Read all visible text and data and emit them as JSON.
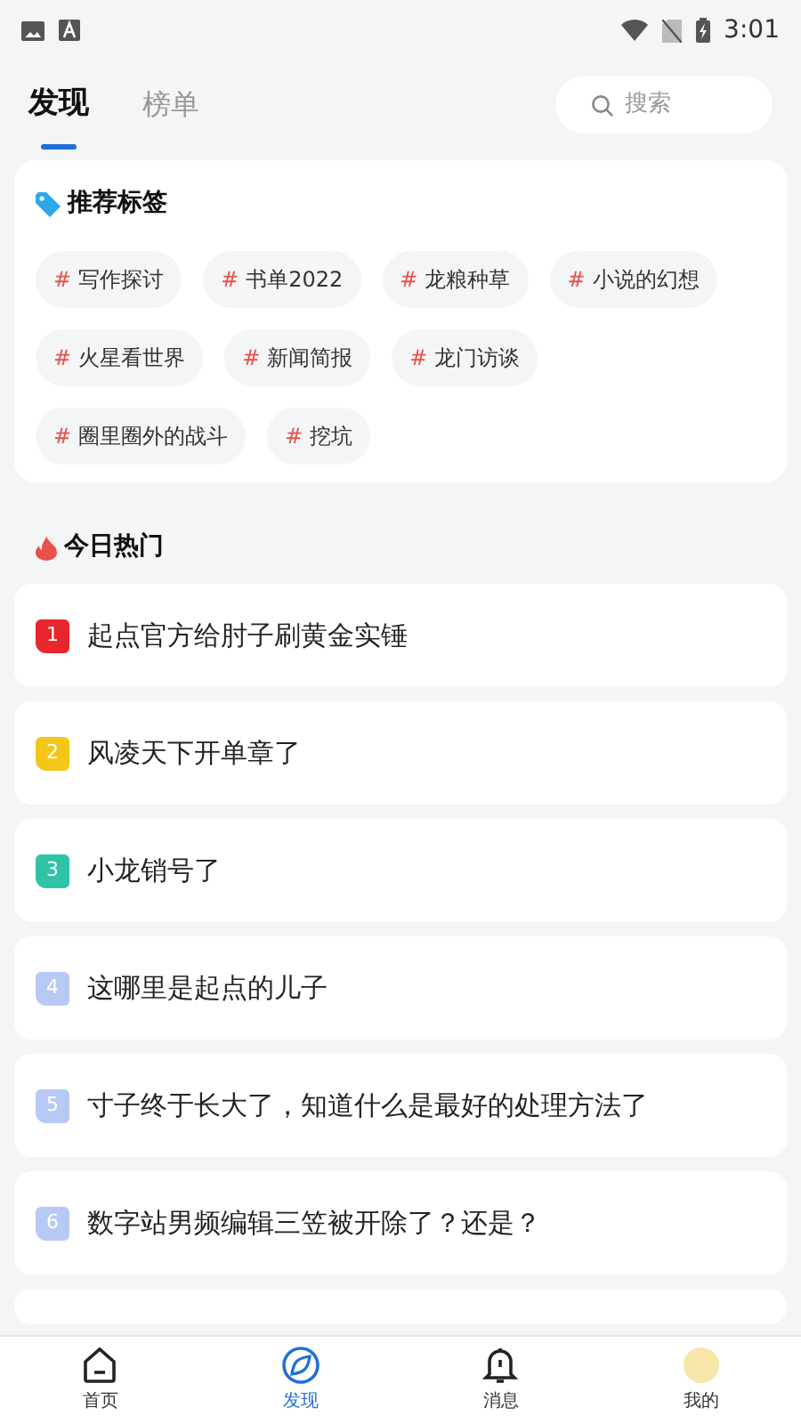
{
  "status_bar": {
    "time": "3:01"
  },
  "tabs": [
    {
      "label": "发现",
      "selected": true
    },
    {
      "label": "榜单",
      "selected": false
    }
  ],
  "search": {
    "placeholder": "搜索"
  },
  "tags_section": {
    "title": "推荐标签",
    "tags": [
      {
        "hash": "#",
        "label": "写作探讨"
      },
      {
        "hash": "#",
        "label": "书单2022"
      },
      {
        "hash": "#",
        "label": "龙粮种草"
      },
      {
        "hash": "#",
        "label": "小说的幻想"
      },
      {
        "hash": "#",
        "label": "火星看世界"
      },
      {
        "hash": "#",
        "label": "新闻简报"
      },
      {
        "hash": "#",
        "label": "龙门访谈"
      },
      {
        "hash": "#",
        "label": "圈里圈外的战斗"
      },
      {
        "hash": "#",
        "label": "挖坑"
      }
    ]
  },
  "hot_section": {
    "title": "今日热门",
    "items": [
      {
        "rank": "1",
        "color": "#e8262d",
        "title": "起点官方给肘子刷黄金实锤"
      },
      {
        "rank": "2",
        "color": "#f5c518",
        "title": "风凌天下开单章了"
      },
      {
        "rank": "3",
        "color": "#2ec4a5",
        "title": "小龙销号了"
      },
      {
        "rank": "4",
        "color": "#b9c9f6",
        "title": "这哪里是起点的儿子"
      },
      {
        "rank": "5",
        "color": "#b9c9f6",
        "title": "寸子终于长大了，知道什么是最好的处理方法了"
      },
      {
        "rank": "6",
        "color": "#b9c9f6",
        "title": "数字站男频编辑三笠被开除了？还是？"
      }
    ]
  },
  "bottom_nav": [
    {
      "kind": "home",
      "label": "首页",
      "selected": false
    },
    {
      "kind": "discover",
      "label": "发现",
      "selected": true
    },
    {
      "kind": "bell",
      "label": "消息",
      "selected": false
    },
    {
      "kind": "me",
      "label": "我的",
      "selected": false
    }
  ]
}
